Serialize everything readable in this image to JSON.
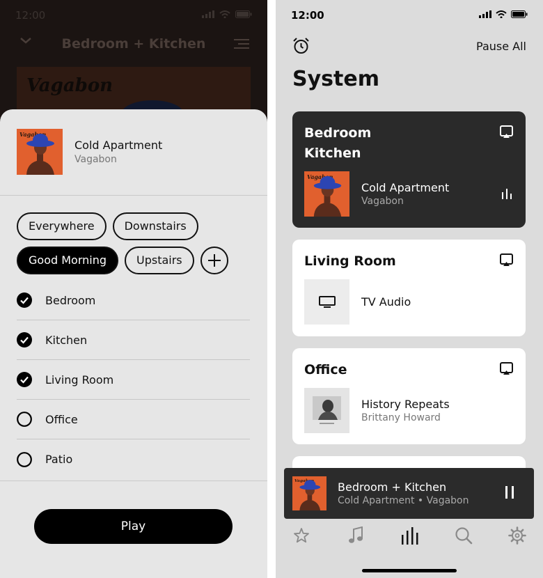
{
  "colors": {
    "sheet_bg": "#e6e6e6",
    "system_bg": "#dcdcdc",
    "dark_card": "#2a2a2a",
    "accent": "#000000",
    "album_orange": "#e1602e",
    "hat_blue": "#2c45b3"
  },
  "left": {
    "status_time": "12:00",
    "background_title": "Bedroom + Kitchen",
    "background_art_text": "Vagabon",
    "now_playing": {
      "track": "Cold Apartment",
      "artist": "Vagabon",
      "art_label": "Vagabon"
    },
    "groups": [
      {
        "label": "Everywhere",
        "active": false
      },
      {
        "label": "Downstairs",
        "active": false
      },
      {
        "label": "Good Morning",
        "active": true
      },
      {
        "label": "Upstairs",
        "active": false
      }
    ],
    "rooms": [
      {
        "label": "Bedroom",
        "checked": true
      },
      {
        "label": "Kitchen",
        "checked": true
      },
      {
        "label": "Living Room",
        "checked": true
      },
      {
        "label": "Office",
        "checked": false
      },
      {
        "label": "Patio",
        "checked": false
      }
    ],
    "play_label": "Play"
  },
  "right": {
    "status_time": "12:00",
    "pause_all": "Pause All",
    "title": "System",
    "cards": {
      "bedroom_kitchen": {
        "name_line1": "Bedroom",
        "name_line2": "Kitchen",
        "track": "Cold Apartment",
        "artist": "Vagabon",
        "art_label": "Vagabon"
      },
      "living_room": {
        "name": "Living Room",
        "track": "TV Audio"
      },
      "office": {
        "name": "Office",
        "track": "History Repeats",
        "artist": "Brittany Howard"
      }
    },
    "mini_player": {
      "room": "Bedroom + Kitchen",
      "detail": "Cold Apartment • Vagabon",
      "art_label": "Vagabon"
    },
    "tabs": [
      "star-icon",
      "music-note-icon",
      "rooms-bars-icon",
      "search-icon",
      "gear-icon"
    ],
    "active_tab": "rooms-bars-icon"
  }
}
